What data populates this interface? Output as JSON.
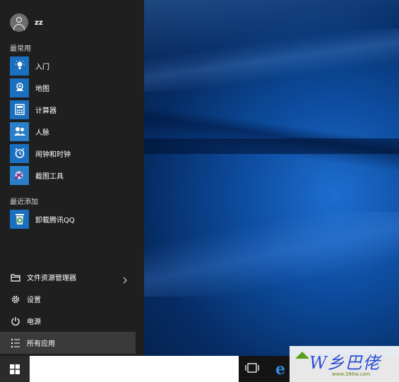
{
  "user": {
    "name": "zz"
  },
  "sections": {
    "most_used": "最常用",
    "recently_added": "最近添加"
  },
  "most_used_apps": [
    {
      "label": "入门",
      "icon": "lightbulb-icon"
    },
    {
      "label": "地图",
      "icon": "map-icon"
    },
    {
      "label": "计算器",
      "icon": "calculator-icon"
    },
    {
      "label": "人脉",
      "icon": "people-icon"
    },
    {
      "label": "闹钟和时钟",
      "icon": "alarm-clock-icon"
    },
    {
      "label": "截图工具",
      "icon": "snipping-tool-icon"
    }
  ],
  "recent_apps": [
    {
      "label": "卸载腾讯QQ",
      "icon": "recycle-bin-icon"
    }
  ],
  "bottom_items": {
    "file_explorer": "文件资源管理器",
    "settings": "设置",
    "power": "电源",
    "all_apps": "所有应用"
  },
  "watermark": {
    "text": "W乡巴佬",
    "url": "www.386w.com"
  },
  "colors": {
    "tile_blue": "#1a6fbf",
    "menu_bg": "#1f1f1f",
    "taskbar_bg": "#141414"
  }
}
